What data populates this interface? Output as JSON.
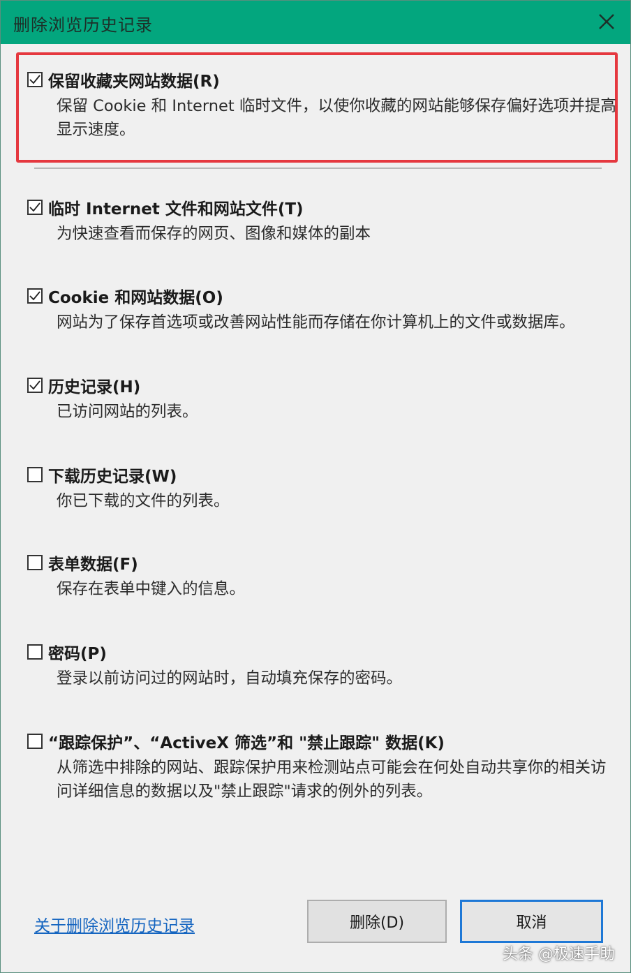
{
  "window": {
    "title": "删除浏览历史记录"
  },
  "options": [
    {
      "label": "保留收藏夹网站数据(R)",
      "description": "保留 Cookie 和 Internet 临时文件，以使你收藏的网站能够保存偏好选项并提高显示速度。",
      "checked": true
    },
    {
      "label": "临时 Internet 文件和网站文件(T)",
      "description": "为快速查看而保存的网页、图像和媒体的副本",
      "checked": true
    },
    {
      "label": "Cookie 和网站数据(O)",
      "description": "网站为了保存首选项或改善网站性能而存储在你计算机上的文件或数据库。",
      "checked": true
    },
    {
      "label": "历史记录(H)",
      "description": "已访问网站的列表。",
      "checked": true
    },
    {
      "label": "下载历史记录(W)",
      "description": "你已下载的文件的列表。",
      "checked": false
    },
    {
      "label": "表单数据(F)",
      "description": "保存在表单中键入的信息。",
      "checked": false
    },
    {
      "label": "密码(P)",
      "description": "登录以前访问过的网站时，自动填充保存的密码。",
      "checked": false
    },
    {
      "label": "“跟踪保护”、“ActiveX 筛选”和 \"禁止跟踪\" 数据(K)",
      "description": "从筛选中排除的网站、跟踪保护用来检测站点可能会在何处自动共享你的相关访问详细信息的数据以及\"禁止跟踪\"请求的例外的列表。",
      "checked": false
    }
  ],
  "footer": {
    "link": "关于删除浏览历史记录",
    "delete_button": "删除(D)",
    "cancel_button": "取消"
  },
  "watermark": "头条 @极速手助",
  "colors": {
    "titlebar": "#03a67e",
    "highlight_border": "#e5383f",
    "link": "#1565c0",
    "focus_border": "#1e78d6"
  }
}
